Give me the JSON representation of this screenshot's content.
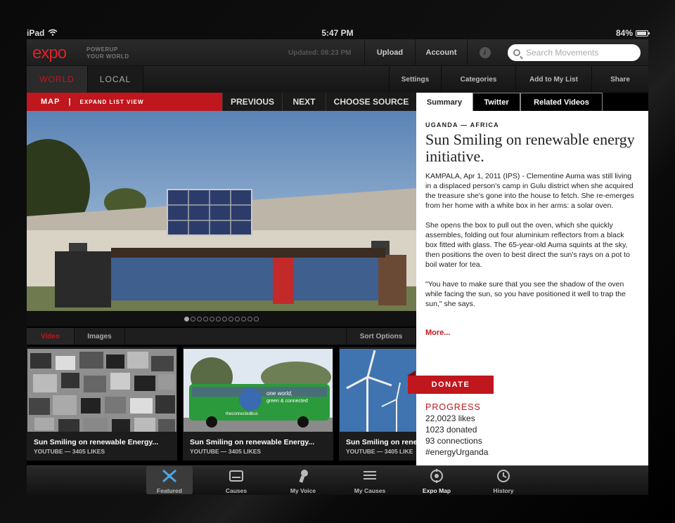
{
  "status_bar": {
    "device": "iPad",
    "time": "5:47 PM",
    "battery": "84%"
  },
  "header": {
    "logo": "expo",
    "tagline_1": "POWERUP",
    "tagline_2": "YOUR WORLD",
    "updated": "Updated: 08:23 PM",
    "upload": "Upload",
    "account": "Account",
    "search_placeholder": "Search Movements"
  },
  "scope_tabs": [
    "WORLD",
    "LOCAL"
  ],
  "actions": [
    "Settings",
    "Categories",
    "Add to My List",
    "Share"
  ],
  "map_bar": {
    "map": "MAP",
    "separator": "|",
    "expand": "EXPAND LIST VIEW"
  },
  "nav": {
    "previous": "PREVIOUS",
    "next": "NEXT",
    "choose_source": "CHOOSE SOURCE"
  },
  "panel_tabs": [
    "Summary",
    "Twitter",
    "Related Videos"
  ],
  "media_tabs": {
    "video": "Video",
    "images": "Images",
    "sort": "Sort Options"
  },
  "carousel": {
    "total": 12,
    "active": 0
  },
  "thumbnails": [
    {
      "title": "Sun Smiling on renewable Energy...",
      "source": "YOUTUBE — 3405 LIKES"
    },
    {
      "title": "Sun Smiling on renewable Energy...",
      "source": "YOUTUBE — 3405 LIKES"
    },
    {
      "title": "Sun Smiling on rene",
      "source": "YOUTUBE — 3405 LIKE"
    }
  ],
  "bus_text": {
    "line1": "one world,",
    "line2": "green & connected",
    "line3": "theconnectedbus"
  },
  "article": {
    "region": "UGANDA — AFRICA",
    "headline": "Sun Smiling on renewable energy initiative.",
    "paragraphs": [
      "KAMPALA, Apr 1, 2011 (IPS) - Clementine Auma was still living in a displaced person's camp in Gulu district when she acquired the treasure she's gone into the house to fetch. She re-emerges from her home with a white box in her arms: a solar oven.",
      "She opens the box to pull out the oven, which she quickly assembles, folding out four aluminium reflectors from a black box fitted with glass. The 65-year-old Auma squints at the sky, then positions the oven to best direct the sun's rays on a pot to boil water for tea.",
      "\"You have to make sure that you see the shadow of the oven while facing the sun, so you have positioned it well to trap the sun,\" she says."
    ],
    "more": "More...",
    "donate": "DONATE",
    "progress_title": "PROGRESS",
    "likes": "22,0023 likes",
    "donated": "1023 donated",
    "connections": "93 connections",
    "hashtag": "#energyUrganda"
  },
  "tab_bar": [
    {
      "label": "Featured",
      "icon": "featured-icon"
    },
    {
      "label": "Causes",
      "icon": "causes-icon"
    },
    {
      "label": "My Voice",
      "icon": "my-voice-icon"
    },
    {
      "label": "My Causes",
      "icon": "my-causes-icon"
    },
    {
      "label": "Expo Map",
      "icon": "target-icon"
    },
    {
      "label": "History",
      "icon": "clock-icon"
    }
  ],
  "colors": {
    "brand_red": "#c0161d",
    "panel_bg": "#ffffff",
    "chrome_dark": "#1d1d1d"
  }
}
